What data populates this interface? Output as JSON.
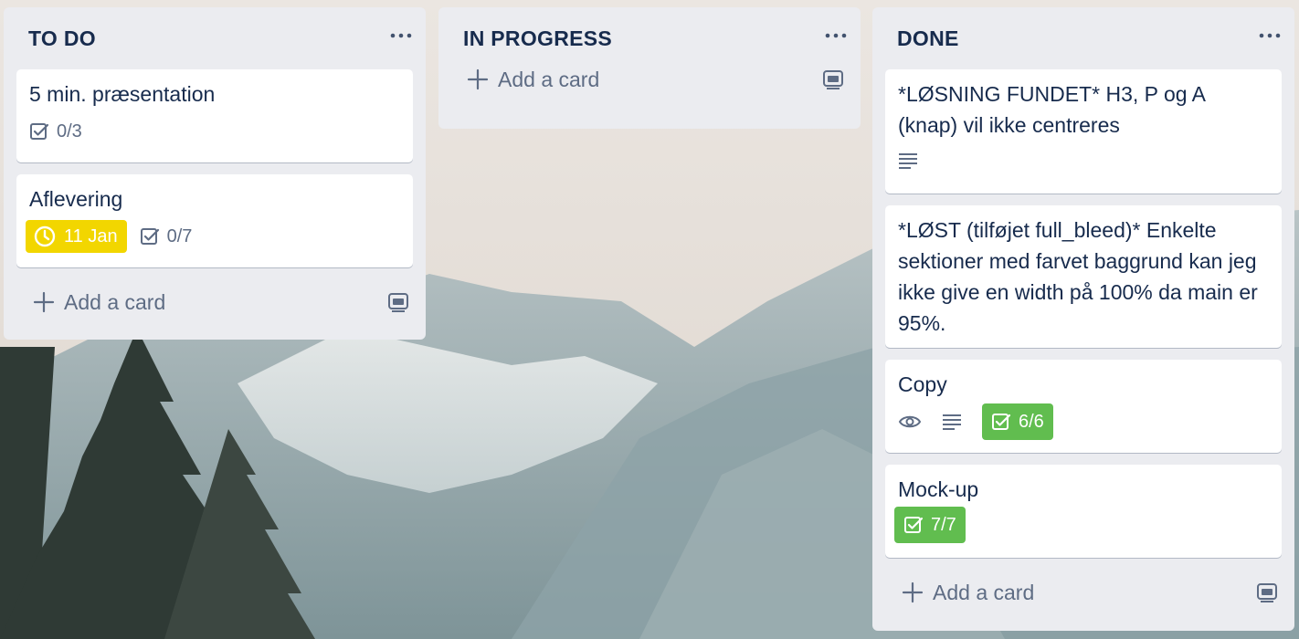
{
  "colors": {
    "list_bg": "#ebecf0",
    "card_bg": "#ffffff",
    "text": "#172b4d",
    "muted": "#5e6c84",
    "complete_green": "#61bd4f",
    "due_yellow": "#f2d600"
  },
  "lists": [
    {
      "title": "TO DO",
      "menu_icon": "ellipsis-icon",
      "cards": [
        {
          "title": "5 min. præsentation",
          "checklist": "0/3"
        },
        {
          "title": "Aflevering",
          "due": "11 Jan",
          "checklist": "0/7"
        }
      ],
      "add_card_label": "Add a card",
      "template_icon": "card-template-icon"
    },
    {
      "title": "IN PROGRESS",
      "menu_icon": "ellipsis-icon",
      "cards": [],
      "add_card_label": "Add a card",
      "template_icon": "card-template-icon"
    },
    {
      "title": "DONE",
      "menu_icon": "ellipsis-icon",
      "cards": [
        {
          "title": "*LØSNING FUNDET* H3, P og A (knap) vil ikke centreres",
          "has_description": true
        },
        {
          "title": "*LØST (tilføjet full_bleed)* Enkelte sektioner med farvet baggrund kan jeg ikke give en width på 100% da main er 95%."
        },
        {
          "title": "Copy",
          "watching": true,
          "has_description": true,
          "checklist": "6/6",
          "checklist_complete": true
        },
        {
          "title": "Mock-up",
          "checklist": "7/7",
          "checklist_complete": true
        }
      ],
      "add_card_label": "Add a card",
      "template_icon": "card-template-icon"
    }
  ]
}
